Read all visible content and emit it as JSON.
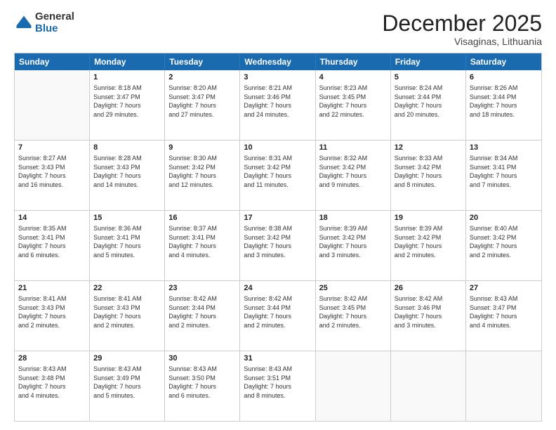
{
  "logo": {
    "general": "General",
    "blue": "Blue"
  },
  "title": "December 2025",
  "location": "Visaginas, Lithuania",
  "header_days": [
    "Sunday",
    "Monday",
    "Tuesday",
    "Wednesday",
    "Thursday",
    "Friday",
    "Saturday"
  ],
  "weeks": [
    [
      {
        "day": "",
        "info": ""
      },
      {
        "day": "1",
        "info": "Sunrise: 8:18 AM\nSunset: 3:47 PM\nDaylight: 7 hours\nand 29 minutes."
      },
      {
        "day": "2",
        "info": "Sunrise: 8:20 AM\nSunset: 3:47 PM\nDaylight: 7 hours\nand 27 minutes."
      },
      {
        "day": "3",
        "info": "Sunrise: 8:21 AM\nSunset: 3:46 PM\nDaylight: 7 hours\nand 24 minutes."
      },
      {
        "day": "4",
        "info": "Sunrise: 8:23 AM\nSunset: 3:45 PM\nDaylight: 7 hours\nand 22 minutes."
      },
      {
        "day": "5",
        "info": "Sunrise: 8:24 AM\nSunset: 3:44 PM\nDaylight: 7 hours\nand 20 minutes."
      },
      {
        "day": "6",
        "info": "Sunrise: 8:26 AM\nSunset: 3:44 PM\nDaylight: 7 hours\nand 18 minutes."
      }
    ],
    [
      {
        "day": "7",
        "info": "Sunrise: 8:27 AM\nSunset: 3:43 PM\nDaylight: 7 hours\nand 16 minutes."
      },
      {
        "day": "8",
        "info": "Sunrise: 8:28 AM\nSunset: 3:43 PM\nDaylight: 7 hours\nand 14 minutes."
      },
      {
        "day": "9",
        "info": "Sunrise: 8:30 AM\nSunset: 3:42 PM\nDaylight: 7 hours\nand 12 minutes."
      },
      {
        "day": "10",
        "info": "Sunrise: 8:31 AM\nSunset: 3:42 PM\nDaylight: 7 hours\nand 11 minutes."
      },
      {
        "day": "11",
        "info": "Sunrise: 8:32 AM\nSunset: 3:42 PM\nDaylight: 7 hours\nand 9 minutes."
      },
      {
        "day": "12",
        "info": "Sunrise: 8:33 AM\nSunset: 3:42 PM\nDaylight: 7 hours\nand 8 minutes."
      },
      {
        "day": "13",
        "info": "Sunrise: 8:34 AM\nSunset: 3:41 PM\nDaylight: 7 hours\nand 7 minutes."
      }
    ],
    [
      {
        "day": "14",
        "info": "Sunrise: 8:35 AM\nSunset: 3:41 PM\nDaylight: 7 hours\nand 6 minutes."
      },
      {
        "day": "15",
        "info": "Sunrise: 8:36 AM\nSunset: 3:41 PM\nDaylight: 7 hours\nand 5 minutes."
      },
      {
        "day": "16",
        "info": "Sunrise: 8:37 AM\nSunset: 3:41 PM\nDaylight: 7 hours\nand 4 minutes."
      },
      {
        "day": "17",
        "info": "Sunrise: 8:38 AM\nSunset: 3:42 PM\nDaylight: 7 hours\nand 3 minutes."
      },
      {
        "day": "18",
        "info": "Sunrise: 8:39 AM\nSunset: 3:42 PM\nDaylight: 7 hours\nand 3 minutes."
      },
      {
        "day": "19",
        "info": "Sunrise: 8:39 AM\nSunset: 3:42 PM\nDaylight: 7 hours\nand 2 minutes."
      },
      {
        "day": "20",
        "info": "Sunrise: 8:40 AM\nSunset: 3:42 PM\nDaylight: 7 hours\nand 2 minutes."
      }
    ],
    [
      {
        "day": "21",
        "info": "Sunrise: 8:41 AM\nSunset: 3:43 PM\nDaylight: 7 hours\nand 2 minutes."
      },
      {
        "day": "22",
        "info": "Sunrise: 8:41 AM\nSunset: 3:43 PM\nDaylight: 7 hours\nand 2 minutes."
      },
      {
        "day": "23",
        "info": "Sunrise: 8:42 AM\nSunset: 3:44 PM\nDaylight: 7 hours\nand 2 minutes."
      },
      {
        "day": "24",
        "info": "Sunrise: 8:42 AM\nSunset: 3:44 PM\nDaylight: 7 hours\nand 2 minutes."
      },
      {
        "day": "25",
        "info": "Sunrise: 8:42 AM\nSunset: 3:45 PM\nDaylight: 7 hours\nand 2 minutes."
      },
      {
        "day": "26",
        "info": "Sunrise: 8:42 AM\nSunset: 3:46 PM\nDaylight: 7 hours\nand 3 minutes."
      },
      {
        "day": "27",
        "info": "Sunrise: 8:43 AM\nSunset: 3:47 PM\nDaylight: 7 hours\nand 4 minutes."
      }
    ],
    [
      {
        "day": "28",
        "info": "Sunrise: 8:43 AM\nSunset: 3:48 PM\nDaylight: 7 hours\nand 4 minutes."
      },
      {
        "day": "29",
        "info": "Sunrise: 8:43 AM\nSunset: 3:49 PM\nDaylight: 7 hours\nand 5 minutes."
      },
      {
        "day": "30",
        "info": "Sunrise: 8:43 AM\nSunset: 3:50 PM\nDaylight: 7 hours\nand 6 minutes."
      },
      {
        "day": "31",
        "info": "Sunrise: 8:43 AM\nSunset: 3:51 PM\nDaylight: 7 hours\nand 8 minutes."
      },
      {
        "day": "",
        "info": ""
      },
      {
        "day": "",
        "info": ""
      },
      {
        "day": "",
        "info": ""
      }
    ]
  ]
}
